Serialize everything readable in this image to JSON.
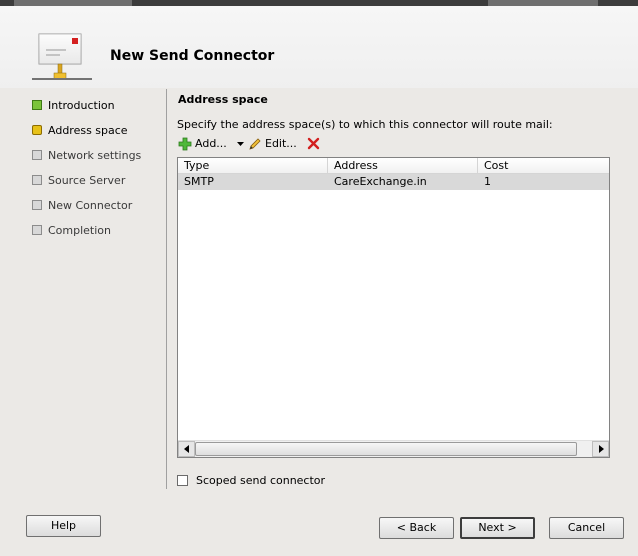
{
  "window": {
    "title": "New Send Connector"
  },
  "wizard_steps": [
    {
      "label": "Introduction",
      "state": "done"
    },
    {
      "label": "Address space",
      "state": "current"
    },
    {
      "label": "Network settings",
      "state": "future"
    },
    {
      "label": "Source Server",
      "state": "future"
    },
    {
      "label": "New Connector",
      "state": "future"
    },
    {
      "label": "Completion",
      "state": "future"
    }
  ],
  "main": {
    "section_title": "Address space",
    "description": "Specify the address space(s) to which this connector will route mail:",
    "toolbar": {
      "add_label": "Add...",
      "edit_label": "Edit..."
    },
    "table": {
      "columns": [
        "Type",
        "Address",
        "Cost"
      ],
      "rows": [
        {
          "type": "SMTP",
          "address": "CareExchange.in",
          "cost": "1"
        }
      ]
    },
    "scoped_label": "Scoped send connector",
    "scoped_checked": false
  },
  "footer": {
    "help_label": "Help",
    "back_label": "< Back",
    "next_label": "Next >",
    "cancel_label": "Cancel"
  },
  "colors": {
    "done": "#7bc43a",
    "current": "#e7c117",
    "future": "#d8d8d8",
    "selected_row": "#d9d9d9"
  }
}
